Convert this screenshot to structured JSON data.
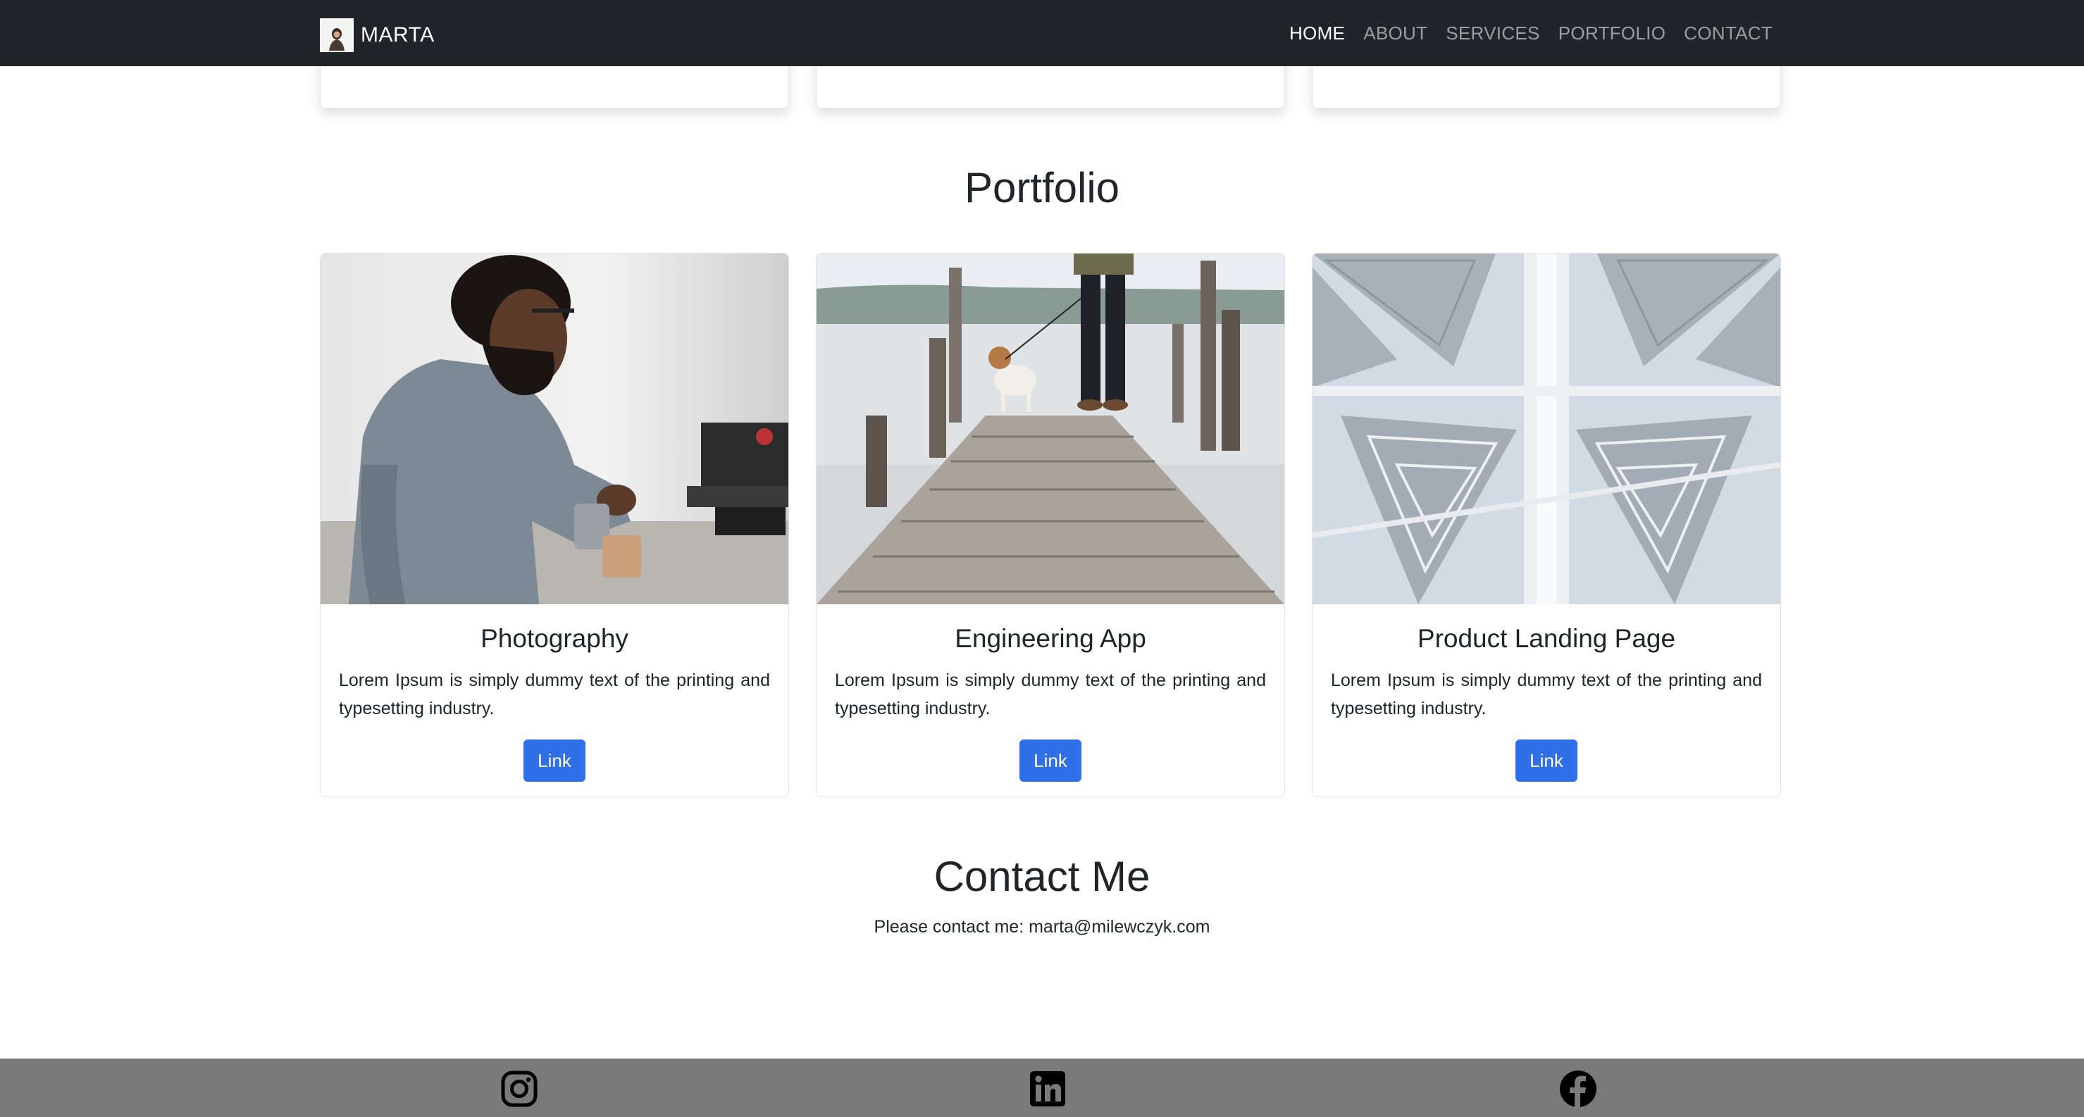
{
  "nav": {
    "brand": "MARTA",
    "links": [
      "HOME",
      "ABOUT",
      "SERVICES",
      "PORTFOLIO",
      "CONTACT"
    ],
    "active": "HOME"
  },
  "portfolio": {
    "title": "Portfolio",
    "cards": [
      {
        "title": "Photography",
        "text": "Lorem Ipsum is simply dummy text of the printing and typesetting industry.",
        "button": "Link"
      },
      {
        "title": "Engineering App",
        "text": "Lorem Ipsum is simply dummy text of the printing and typesetting industry.",
        "button": "Link"
      },
      {
        "title": "Product Landing Page",
        "text": "Lorem Ipsum is simply dummy text of the printing and typesetting industry.",
        "button": "Link"
      }
    ]
  },
  "contact": {
    "title": "Contact Me",
    "text": "Please contact me: marta@milewczyk.com"
  },
  "footer": {
    "icons": [
      "instagram-icon",
      "linkedin-icon",
      "facebook-icon"
    ]
  },
  "colors": {
    "navbar_bg": "#212529",
    "button_bg": "#2f6fe8",
    "footer_bg": "#7a7a7a"
  }
}
